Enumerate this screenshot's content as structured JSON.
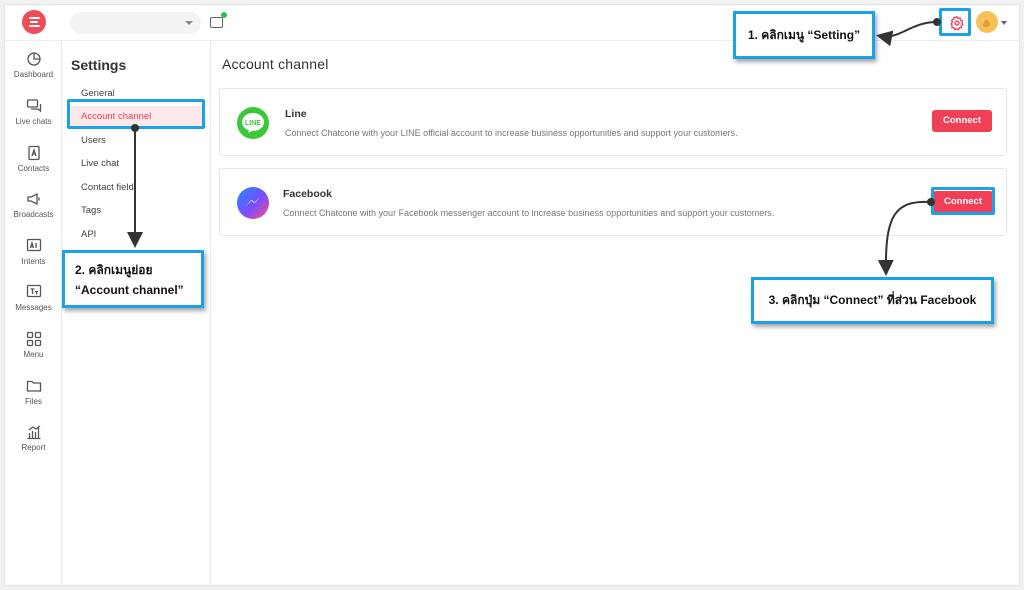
{
  "settings_panel": {
    "title": "Settings",
    "items": [
      {
        "label": "General"
      },
      {
        "label": "Account channel"
      },
      {
        "label": "Users"
      },
      {
        "label": "Live chat"
      },
      {
        "label": "Contact field"
      },
      {
        "label": "Tags"
      },
      {
        "label": "API"
      }
    ],
    "active_item": "Account channel"
  },
  "left_nav": {
    "items": [
      {
        "label": "Dashboard",
        "icon": "pie-chart-icon"
      },
      {
        "label": "Live chats",
        "icon": "chat-bubbles-icon"
      },
      {
        "label": "Contacts",
        "icon": "contact-book-icon"
      },
      {
        "label": "Broadcasts",
        "icon": "megaphone-icon"
      },
      {
        "label": "Intents",
        "icon": "ai-icon"
      },
      {
        "label": "Messages",
        "icon": "text-message-icon"
      },
      {
        "label": "Menu",
        "icon": "grid-icon"
      },
      {
        "label": "Files",
        "icon": "folder-icon"
      },
      {
        "label": "Report",
        "icon": "bar-chart-icon"
      }
    ]
  },
  "main": {
    "title": "Account channel",
    "channels": [
      {
        "name": "Line",
        "description": "Connect Chatcone with your LINE official account to increase business opportunities and support your customers.",
        "button_label": "Connect",
        "icon": "line-icon",
        "icon_text": "LINE"
      },
      {
        "name": "Facebook",
        "description": "Connect Chatcone with your Facebook messenger account to increase business opportunities and support your customers.",
        "button_label": "Connect",
        "icon": "messenger-icon"
      }
    ]
  },
  "annotations": {
    "step1": "1. คลิกเมนู “Setting”",
    "step2_line1": "2. คลิกเมนูย่อย",
    "step2_line2": "“Account channel”",
    "step3": "3. คลิกปุ่ม “Connect” ที่ส่วน Facebook"
  },
  "colors": {
    "brand_red": "#ef4057",
    "annotation_blue": "#1aa1e6",
    "line_green": "#3ac83a",
    "online_green": "#2bbd4e"
  }
}
